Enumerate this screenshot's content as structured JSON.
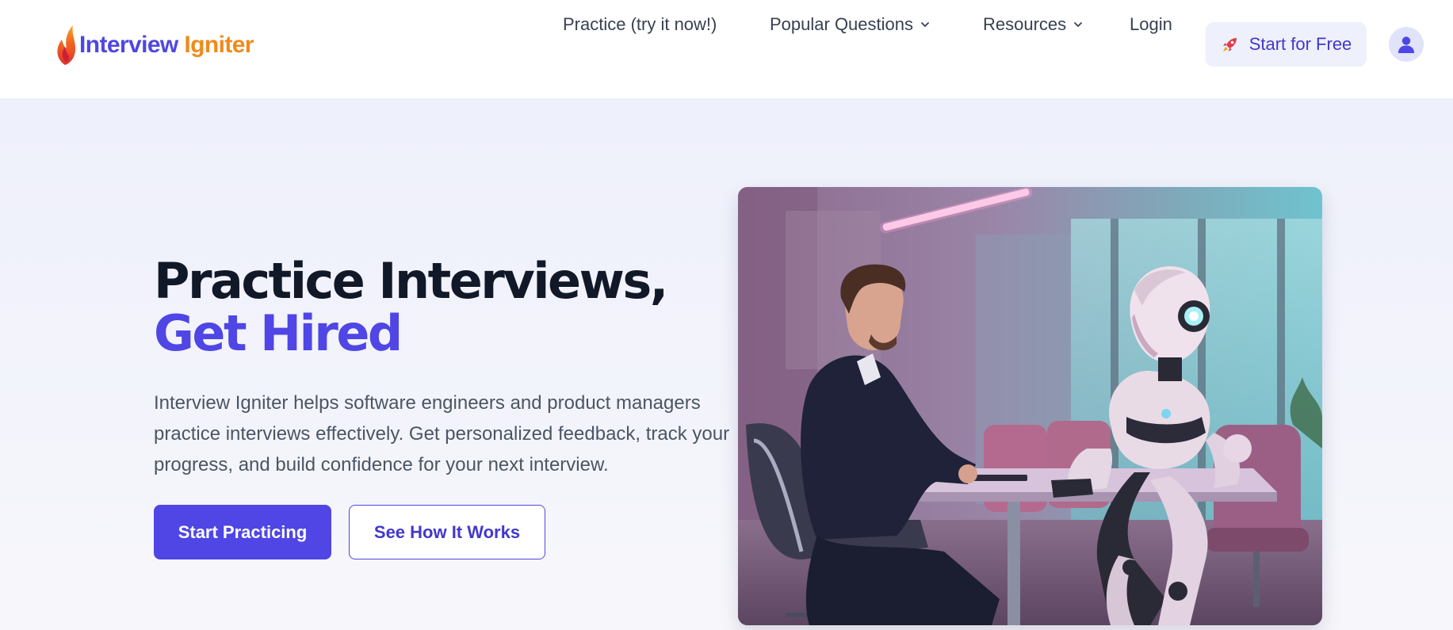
{
  "brand": {
    "name_part1": "Interview",
    "name_part2": "Igniter"
  },
  "nav": {
    "practice": "Practice (try it now!)",
    "popular_questions": "Popular Questions",
    "resources": "Resources",
    "login": "Login",
    "start_free": "Start for Free"
  },
  "icons": {
    "logo": "flame-icon",
    "dropdown": "chevron-down-icon",
    "cta": "rocket-icon",
    "account": "user-icon"
  },
  "hero": {
    "headline_main": "Practice Interviews, ",
    "headline_accent": "Get Hired",
    "description": "Interview Igniter helps software engineers and product managers practice interviews effectively. Get personalized feedback, track your progress, and build confidence for your next interview.",
    "primary_button": "Start Practicing",
    "secondary_button": "See How It Works"
  },
  "colors": {
    "brand_indigo": "#4f46e5",
    "brand_orange": "#f08a1c",
    "hero_background": "#eef0fb",
    "text_dark": "#111827",
    "text_muted": "#4b5563"
  }
}
